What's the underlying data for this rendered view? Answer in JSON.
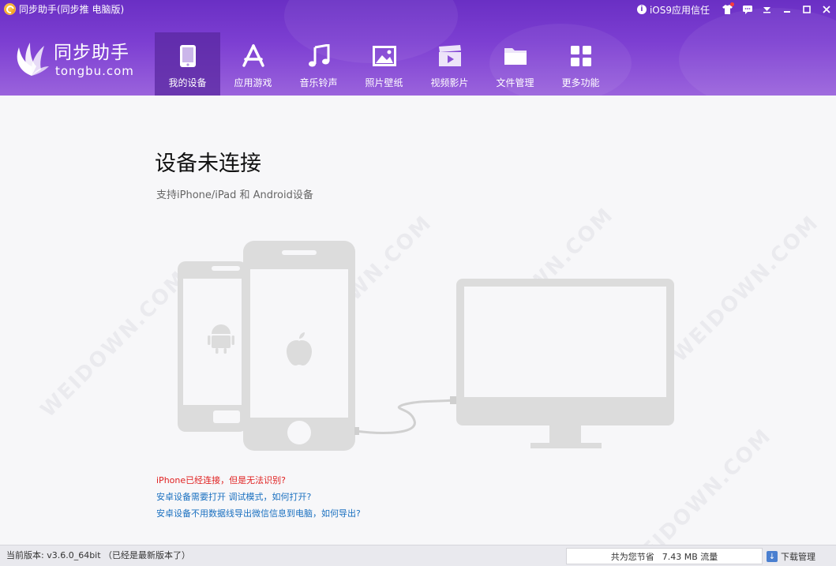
{
  "window": {
    "title": "同步助手(同步推 电脑版)",
    "ios_trust_label": "iOS9应用信任"
  },
  "logo": {
    "cn": "同步助手",
    "en": "tongbu.com"
  },
  "nav": [
    {
      "label": "我的设备",
      "icon": "phone-icon",
      "active": true
    },
    {
      "label": "应用游戏",
      "icon": "app-store-icon",
      "active": false
    },
    {
      "label": "音乐铃声",
      "icon": "music-note-icon",
      "active": false
    },
    {
      "label": "照片壁纸",
      "icon": "picture-icon",
      "active": false
    },
    {
      "label": "视频影片",
      "icon": "video-clapper-icon",
      "active": false
    },
    {
      "label": "文件管理",
      "icon": "folder-icon",
      "active": false
    },
    {
      "label": "更多功能",
      "icon": "grid-icon",
      "active": false
    }
  ],
  "main": {
    "title": "设备未连接",
    "subtitle": "支持iPhone/iPad 和 Android设备",
    "links": [
      {
        "text": "iPhone已经连接，但是无法识别?",
        "color": "#e02020"
      },
      {
        "text": "安卓设备需要打开 调试模式，如何打开?",
        "color": "#1a70c0"
      },
      {
        "text": "安卓设备不用数据线导出微信信息到电脑，如何导出?",
        "color": "#1a70c0"
      }
    ]
  },
  "statusbar": {
    "version": "当前版本: v3.6.0_64bit （已经是最新版本了）",
    "saved_label": "共为您节省",
    "saved_value": "7.43 MB 流量",
    "download_label": "下载管理"
  },
  "watermark": "WEIDOWN.COM",
  "colors": {
    "header_top": "#6a2fc4",
    "header_bottom": "#9a63dc",
    "link_red": "#e02020",
    "link_blue": "#1a70c0",
    "illustration": "#dcdcdc"
  }
}
